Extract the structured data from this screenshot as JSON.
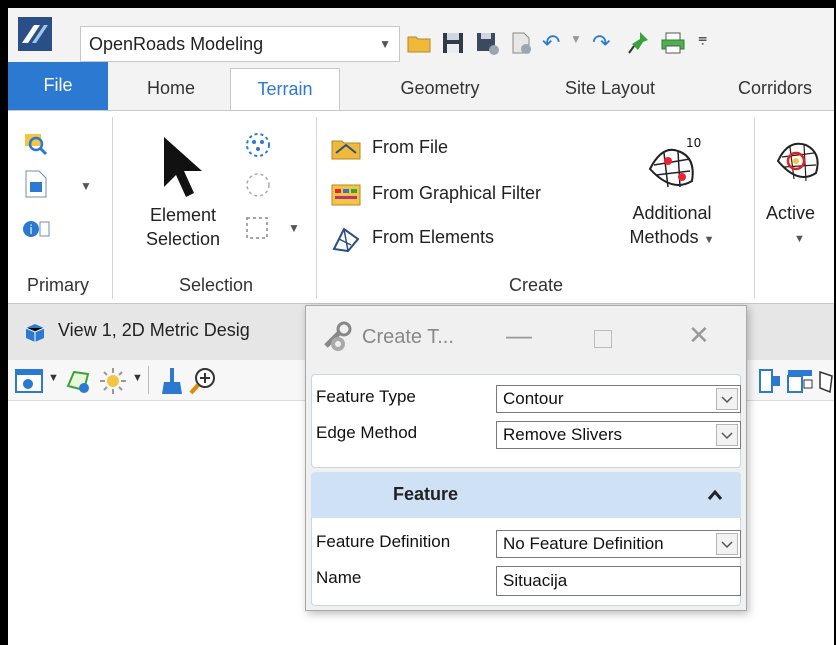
{
  "workflow": {
    "selected": "OpenRoads Modeling"
  },
  "tabs": [
    {
      "label": "File"
    },
    {
      "label": "Home"
    },
    {
      "label": "Terrain"
    },
    {
      "label": "Geometry"
    },
    {
      "label": "Site Layout"
    },
    {
      "label": "Corridors"
    }
  ],
  "ribbon": {
    "groups": {
      "primary": "Primary",
      "selection": "Selection",
      "create": "Create"
    },
    "element_selection": {
      "line1": "Element",
      "line2": "Selection"
    },
    "create_items": [
      "From File",
      "From Graphical Filter",
      "From Elements"
    ],
    "additional": {
      "line1": "Additional",
      "line2": "Methods",
      "badge": "10.0"
    },
    "active": {
      "label": "Active"
    }
  },
  "view": {
    "title": "View 1, 2D Metric Desig"
  },
  "dialog": {
    "title": "Create T...",
    "fields": {
      "feature_type": {
        "label": "Feature Type",
        "value": "Contour"
      },
      "edge_method": {
        "label": "Edge Method",
        "value": "Remove Slivers"
      }
    },
    "section": {
      "title": "Feature",
      "feature_definition": {
        "label": "Feature Definition",
        "value": "No Feature Definition"
      },
      "name": {
        "label": "Name",
        "value": "Situacija"
      }
    }
  },
  "colors": {
    "accent": "#2b79d0",
    "section": "#cfe1f5"
  }
}
